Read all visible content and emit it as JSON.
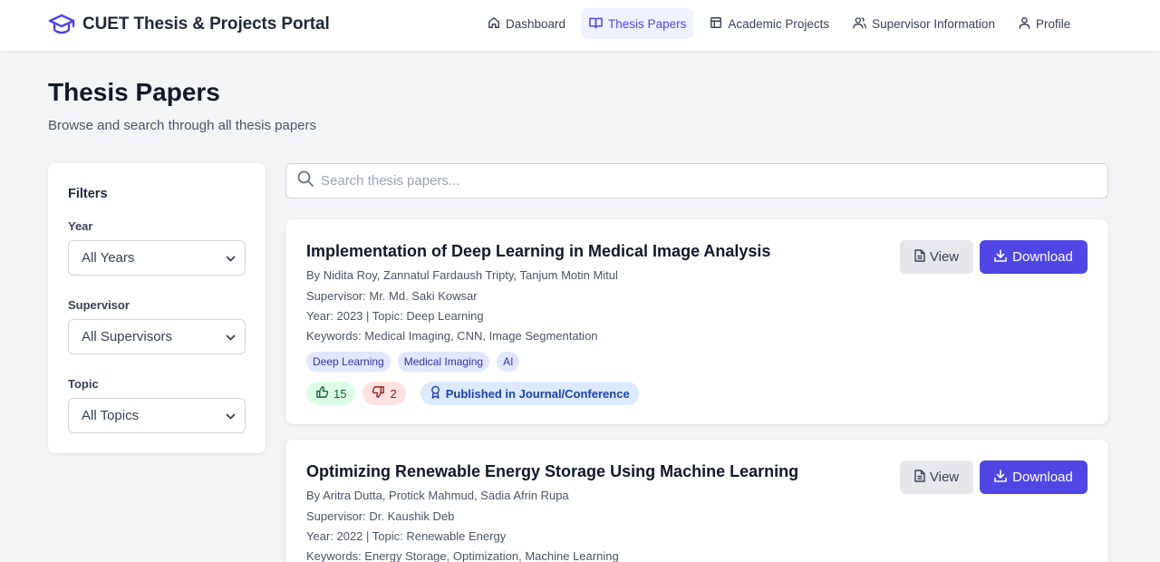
{
  "app": {
    "title": "CUET Thesis & Projects Portal"
  },
  "nav": [
    {
      "label": "Dashboard",
      "icon": "home-icon",
      "active": false
    },
    {
      "label": "Thesis Papers",
      "icon": "book-open-icon",
      "active": true
    },
    {
      "label": "Academic Projects",
      "icon": "layout-icon",
      "active": false
    },
    {
      "label": "Supervisor Information",
      "icon": "users-icon",
      "active": false
    },
    {
      "label": "Profile",
      "icon": "user-icon",
      "active": false
    }
  ],
  "page": {
    "title": "Thesis Papers",
    "subtitle": "Browse and search through all thesis papers"
  },
  "filters": {
    "heading": "Filters",
    "year": {
      "label": "Year",
      "value": "All Years"
    },
    "supervisor": {
      "label": "Supervisor",
      "value": "All Supervisors"
    },
    "topic": {
      "label": "Topic",
      "value": "All Topics"
    }
  },
  "search": {
    "placeholder": "Search thesis papers..."
  },
  "papers": [
    {
      "title": "Implementation of Deep Learning in Medical Image Analysis",
      "authors": "By Nidita Roy, Zannatul Fardaush Tripty, Tanjum Motin Mitul",
      "supervisor": "Supervisor: Mr. Md. Saki Kowsar",
      "year_topic": "Year: 2023 | Topic: Deep Learning",
      "keywords": "Keywords: Medical Imaging, CNN, Image Segmentation",
      "tags": [
        "Deep Learning",
        "Medical Imaging",
        "AI"
      ],
      "likes": "15",
      "dislikes": "2",
      "status": "Published in Journal/Conference",
      "view_label": "View",
      "download_label": "Download"
    },
    {
      "title": "Optimizing Renewable Energy Storage Using Machine Learning",
      "authors": "By Aritra Dutta, Protick Mahmud, Sadia Afrin Rupa",
      "supervisor": "Supervisor: Dr. Kaushik Deb",
      "year_topic": "Year: 2022 | Topic: Renewable Energy",
      "keywords": "Keywords: Energy Storage, Optimization, Machine Learning",
      "view_label": "View",
      "download_label": "Download"
    }
  ],
  "colors": {
    "primary": "#4f46e5",
    "active_bg": "#eef2ff",
    "tag_bg": "#e0e7ff",
    "like_bg": "#dcfce7",
    "dislike_bg": "#fee2e2",
    "published_bg": "#dbeafe"
  }
}
